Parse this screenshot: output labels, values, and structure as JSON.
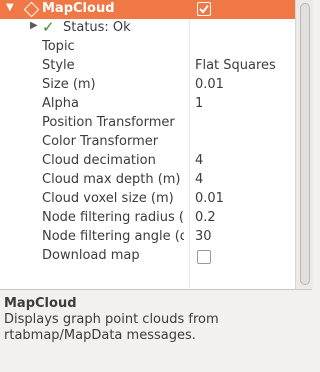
{
  "display": {
    "name": "MapCloud",
    "enabled": true
  },
  "status": {
    "label": "Status: Ok"
  },
  "properties": [
    {
      "label": "Topic",
      "value": ""
    },
    {
      "label": "Style",
      "value": "Flat Squares"
    },
    {
      "label": "Size (m)",
      "value": "0.01"
    },
    {
      "label": "Alpha",
      "value": "1"
    },
    {
      "label": "Position Transformer",
      "value": ""
    },
    {
      "label": "Color Transformer",
      "value": ""
    },
    {
      "label": "Cloud decimation",
      "value": "4"
    },
    {
      "label": "Cloud max depth (m)",
      "value": "4"
    },
    {
      "label": "Cloud voxel size (m)",
      "value": "0.01"
    },
    {
      "label": "Node filtering radius (m)",
      "value": "0.2"
    },
    {
      "label": "Node filtering angle (degrees)",
      "value": "30"
    },
    {
      "label": "Download map",
      "checked": false
    }
  ],
  "description": {
    "title": "MapCloud",
    "text": "Displays graph point clouds from rtabmap/MapData messages."
  },
  "colors": {
    "selection": "#f07746",
    "status_ok": "#3a8f2d"
  },
  "icons": {
    "expand_open": "triangle-down-icon",
    "expand_closed": "triangle-right-icon",
    "display": "diamond-icon",
    "status": "checkmark-icon"
  }
}
